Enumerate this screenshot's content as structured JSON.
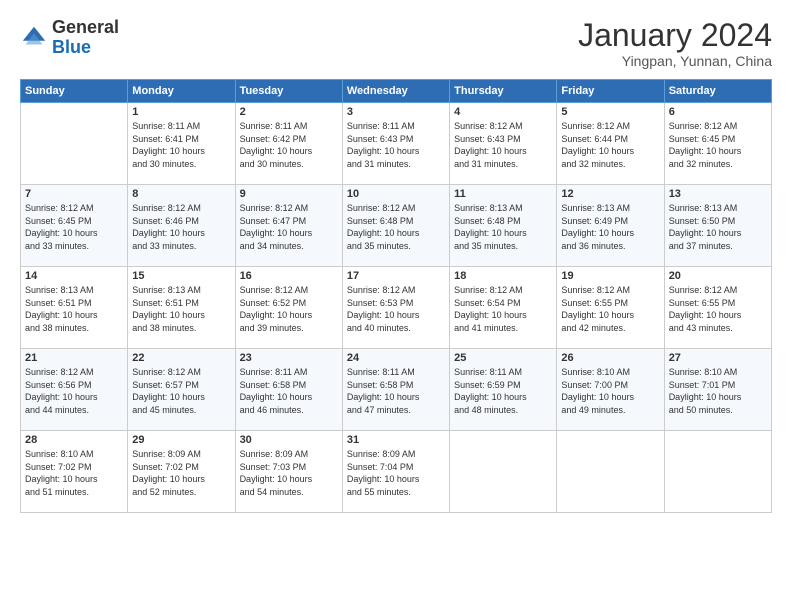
{
  "logo": {
    "general": "General",
    "blue": "Blue"
  },
  "header": {
    "month": "January 2024",
    "location": "Yingpan, Yunnan, China"
  },
  "weekdays": [
    "Sunday",
    "Monday",
    "Tuesday",
    "Wednesday",
    "Thursday",
    "Friday",
    "Saturday"
  ],
  "weeks": [
    [
      {
        "day": "",
        "info": ""
      },
      {
        "day": "1",
        "info": "Sunrise: 8:11 AM\nSunset: 6:41 PM\nDaylight: 10 hours\nand 30 minutes."
      },
      {
        "day": "2",
        "info": "Sunrise: 8:11 AM\nSunset: 6:42 PM\nDaylight: 10 hours\nand 30 minutes."
      },
      {
        "day": "3",
        "info": "Sunrise: 8:11 AM\nSunset: 6:43 PM\nDaylight: 10 hours\nand 31 minutes."
      },
      {
        "day": "4",
        "info": "Sunrise: 8:12 AM\nSunset: 6:43 PM\nDaylight: 10 hours\nand 31 minutes."
      },
      {
        "day": "5",
        "info": "Sunrise: 8:12 AM\nSunset: 6:44 PM\nDaylight: 10 hours\nand 32 minutes."
      },
      {
        "day": "6",
        "info": "Sunrise: 8:12 AM\nSunset: 6:45 PM\nDaylight: 10 hours\nand 32 minutes."
      }
    ],
    [
      {
        "day": "7",
        "info": "Sunrise: 8:12 AM\nSunset: 6:45 PM\nDaylight: 10 hours\nand 33 minutes."
      },
      {
        "day": "8",
        "info": "Sunrise: 8:12 AM\nSunset: 6:46 PM\nDaylight: 10 hours\nand 33 minutes."
      },
      {
        "day": "9",
        "info": "Sunrise: 8:12 AM\nSunset: 6:47 PM\nDaylight: 10 hours\nand 34 minutes."
      },
      {
        "day": "10",
        "info": "Sunrise: 8:12 AM\nSunset: 6:48 PM\nDaylight: 10 hours\nand 35 minutes."
      },
      {
        "day": "11",
        "info": "Sunrise: 8:13 AM\nSunset: 6:48 PM\nDaylight: 10 hours\nand 35 minutes."
      },
      {
        "day": "12",
        "info": "Sunrise: 8:13 AM\nSunset: 6:49 PM\nDaylight: 10 hours\nand 36 minutes."
      },
      {
        "day": "13",
        "info": "Sunrise: 8:13 AM\nSunset: 6:50 PM\nDaylight: 10 hours\nand 37 minutes."
      }
    ],
    [
      {
        "day": "14",
        "info": "Sunrise: 8:13 AM\nSunset: 6:51 PM\nDaylight: 10 hours\nand 38 minutes."
      },
      {
        "day": "15",
        "info": "Sunrise: 8:13 AM\nSunset: 6:51 PM\nDaylight: 10 hours\nand 38 minutes."
      },
      {
        "day": "16",
        "info": "Sunrise: 8:12 AM\nSunset: 6:52 PM\nDaylight: 10 hours\nand 39 minutes."
      },
      {
        "day": "17",
        "info": "Sunrise: 8:12 AM\nSunset: 6:53 PM\nDaylight: 10 hours\nand 40 minutes."
      },
      {
        "day": "18",
        "info": "Sunrise: 8:12 AM\nSunset: 6:54 PM\nDaylight: 10 hours\nand 41 minutes."
      },
      {
        "day": "19",
        "info": "Sunrise: 8:12 AM\nSunset: 6:55 PM\nDaylight: 10 hours\nand 42 minutes."
      },
      {
        "day": "20",
        "info": "Sunrise: 8:12 AM\nSunset: 6:55 PM\nDaylight: 10 hours\nand 43 minutes."
      }
    ],
    [
      {
        "day": "21",
        "info": "Sunrise: 8:12 AM\nSunset: 6:56 PM\nDaylight: 10 hours\nand 44 minutes."
      },
      {
        "day": "22",
        "info": "Sunrise: 8:12 AM\nSunset: 6:57 PM\nDaylight: 10 hours\nand 45 minutes."
      },
      {
        "day": "23",
        "info": "Sunrise: 8:11 AM\nSunset: 6:58 PM\nDaylight: 10 hours\nand 46 minutes."
      },
      {
        "day": "24",
        "info": "Sunrise: 8:11 AM\nSunset: 6:58 PM\nDaylight: 10 hours\nand 47 minutes."
      },
      {
        "day": "25",
        "info": "Sunrise: 8:11 AM\nSunset: 6:59 PM\nDaylight: 10 hours\nand 48 minutes."
      },
      {
        "day": "26",
        "info": "Sunrise: 8:10 AM\nSunset: 7:00 PM\nDaylight: 10 hours\nand 49 minutes."
      },
      {
        "day": "27",
        "info": "Sunrise: 8:10 AM\nSunset: 7:01 PM\nDaylight: 10 hours\nand 50 minutes."
      }
    ],
    [
      {
        "day": "28",
        "info": "Sunrise: 8:10 AM\nSunset: 7:02 PM\nDaylight: 10 hours\nand 51 minutes."
      },
      {
        "day": "29",
        "info": "Sunrise: 8:09 AM\nSunset: 7:02 PM\nDaylight: 10 hours\nand 52 minutes."
      },
      {
        "day": "30",
        "info": "Sunrise: 8:09 AM\nSunset: 7:03 PM\nDaylight: 10 hours\nand 54 minutes."
      },
      {
        "day": "31",
        "info": "Sunrise: 8:09 AM\nSunset: 7:04 PM\nDaylight: 10 hours\nand 55 minutes."
      },
      {
        "day": "",
        "info": ""
      },
      {
        "day": "",
        "info": ""
      },
      {
        "day": "",
        "info": ""
      }
    ]
  ]
}
